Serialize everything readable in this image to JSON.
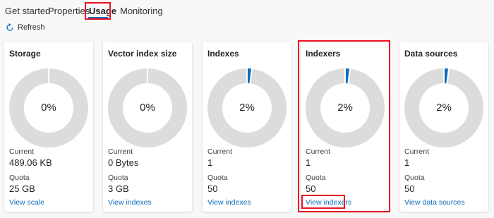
{
  "tabs": [
    {
      "label": "Get started"
    },
    {
      "label": "Properties"
    },
    {
      "label": "Usage"
    },
    {
      "label": "Monitoring"
    }
  ],
  "toolbar": {
    "refresh_label": "Refresh",
    "refresh_icon": "refresh-icon"
  },
  "colors": {
    "accent": "#0f6cbd",
    "donut_track": "#dcdcdc",
    "highlight": "#e81123"
  },
  "current_label": "Current",
  "quota_label": "Quota",
  "cards": [
    {
      "title": "Storage",
      "percent": "0%",
      "fraction": 0,
      "current": "489.06 KB",
      "quota": "25 GB",
      "link": "View scale"
    },
    {
      "title": "Vector index size",
      "percent": "0%",
      "fraction": 0,
      "current": "0 Bytes",
      "quota": "3 GB",
      "link": "View indexes"
    },
    {
      "title": "Indexes",
      "percent": "2%",
      "fraction": 0.02,
      "current": "1",
      "quota": "50",
      "link": "View indexes"
    },
    {
      "title": "Indexers",
      "percent": "2%",
      "fraction": 0.02,
      "current": "1",
      "quota": "50",
      "link": "View indexers"
    },
    {
      "title": "Data sources",
      "percent": "2%",
      "fraction": 0.02,
      "current": "1",
      "quota": "50",
      "link": "View data sources"
    }
  ]
}
